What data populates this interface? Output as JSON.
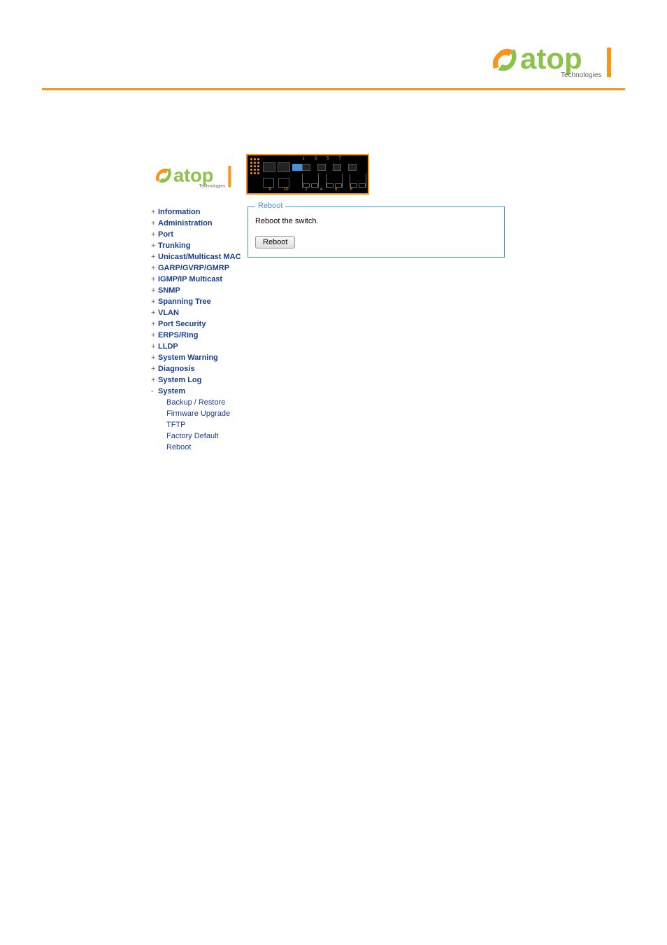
{
  "brand": {
    "name": "atop",
    "subtitle": "Technologies"
  },
  "colors": {
    "accent_orange": "#f7941d",
    "accent_green": "#8bc34a",
    "link_blue": "#1a3e8c",
    "border_blue": "#4a90d9"
  },
  "device": {
    "top_port_labels": [
      "1",
      "3",
      "5",
      "7"
    ],
    "bottom_port_labels": [
      "9",
      "10",
      "2",
      "4",
      "6",
      "8"
    ]
  },
  "sidebar": {
    "items": [
      {
        "label": "Information",
        "expanded": false
      },
      {
        "label": "Administration",
        "expanded": false
      },
      {
        "label": "Port",
        "expanded": false
      },
      {
        "label": "Trunking",
        "expanded": false
      },
      {
        "label": "Unicast/Multicast MAC",
        "expanded": false
      },
      {
        "label": "GARP/GVRP/GMRP",
        "expanded": false
      },
      {
        "label": "IGMP/IP Multicast",
        "expanded": false
      },
      {
        "label": "SNMP",
        "expanded": false
      },
      {
        "label": "Spanning Tree",
        "expanded": false
      },
      {
        "label": "VLAN",
        "expanded": false
      },
      {
        "label": "Port Security",
        "expanded": false
      },
      {
        "label": "ERPS/Ring",
        "expanded": false
      },
      {
        "label": "LLDP",
        "expanded": false
      },
      {
        "label": "System Warning",
        "expanded": false
      },
      {
        "label": "Diagnosis",
        "expanded": false
      },
      {
        "label": "System Log",
        "expanded": false
      },
      {
        "label": "System",
        "expanded": true,
        "children": [
          {
            "label": "Backup / Restore"
          },
          {
            "label": "Firmware Upgrade"
          },
          {
            "label": "TFTP"
          },
          {
            "label": "Factory Default"
          },
          {
            "label": "Reboot"
          }
        ]
      }
    ]
  },
  "panel": {
    "title": "Reboot",
    "message": "Reboot the switch.",
    "button_label": "Reboot"
  }
}
